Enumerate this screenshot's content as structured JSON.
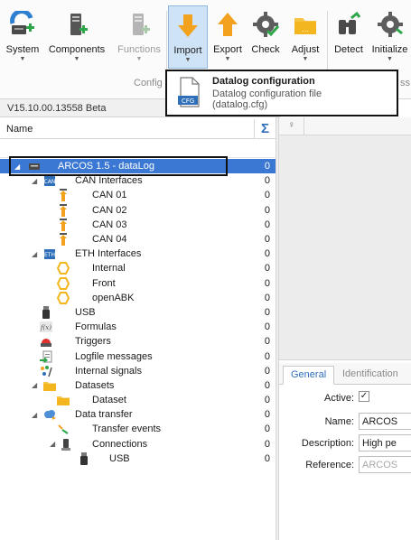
{
  "ribbon": {
    "buttons": [
      {
        "label": "System",
        "icon": "system-add-icon",
        "enabled": true
      },
      {
        "label": "Components",
        "icon": "components-add-icon",
        "enabled": true
      },
      {
        "label": "Functions",
        "icon": "functions-add-icon",
        "enabled": false
      },
      {
        "label": "Import",
        "icon": "import-arrow-icon",
        "enabled": true,
        "active": true
      },
      {
        "label": "Export",
        "icon": "export-arrow-icon",
        "enabled": true
      },
      {
        "label": "Check",
        "icon": "check-gear-icon",
        "enabled": true
      },
      {
        "label": "Adjust",
        "icon": "adjust-folder-icon",
        "enabled": true
      },
      {
        "label": "Detect",
        "icon": "detect-binoculars-icon",
        "enabled": true
      },
      {
        "label": "Initialize",
        "icon": "initialize-gear-icon",
        "enabled": true
      }
    ],
    "group_label": "Config",
    "group_label_right": "ss"
  },
  "version": "V15.10.00.13558 Beta",
  "tree": {
    "name_header": "Name",
    "sigma_header": "Σ",
    "rows": [
      {
        "label": "ARCOS 1.5 - dataLog",
        "count": "0",
        "icon": "device-icon",
        "expander": "◢",
        "selected": true
      },
      {
        "label": "CAN Interfaces",
        "count": "0",
        "icon": "can-interfaces-icon",
        "expander": "◢"
      },
      {
        "label": "CAN 01",
        "count": "0",
        "icon": "can-channel-icon"
      },
      {
        "label": "CAN 02",
        "count": "0",
        "icon": "can-channel-icon"
      },
      {
        "label": "CAN 03",
        "count": "0",
        "icon": "can-channel-icon"
      },
      {
        "label": "CAN 04",
        "count": "0",
        "icon": "can-channel-icon"
      },
      {
        "label": "ETH Interfaces",
        "count": "0",
        "icon": "eth-interfaces-icon",
        "expander": "◢"
      },
      {
        "label": "Internal",
        "count": "0",
        "icon": "eth-port-icon"
      },
      {
        "label": "Front",
        "count": "0",
        "icon": "eth-port-icon"
      },
      {
        "label": "openABK",
        "count": "0",
        "icon": "eth-port-icon"
      },
      {
        "label": "USB",
        "count": "0",
        "icon": "usb-icon"
      },
      {
        "label": "Formulas",
        "count": "0",
        "icon": "formula-icon"
      },
      {
        "label": "Triggers",
        "count": "0",
        "icon": "trigger-icon"
      },
      {
        "label": "Logfile messages",
        "count": "0",
        "icon": "logfile-icon"
      },
      {
        "label": "Internal signals",
        "count": "0",
        "icon": "signals-icon"
      },
      {
        "label": "Datasets",
        "count": "0",
        "icon": "folder-icon",
        "expander": "◢"
      },
      {
        "label": "Dataset",
        "count": "0",
        "icon": "dataset-folder-icon"
      },
      {
        "label": "Data transfer",
        "count": "0",
        "icon": "cloud-transfer-icon",
        "expander": "◢"
      },
      {
        "label": "Transfer events",
        "count": "0",
        "icon": "transfer-events-icon"
      },
      {
        "label": "Connections",
        "count": "0",
        "icon": "connections-icon",
        "expander": "◢"
      },
      {
        "label": "USB",
        "count": "0",
        "icon": "usb-icon"
      }
    ]
  },
  "right_pane": {
    "pin_glyph": "♀",
    "tabs": [
      "General",
      "Identification"
    ],
    "properties": {
      "active_label": "Active:",
      "active_checked": true,
      "name_label": "Name:",
      "name_value": "ARCOS",
      "description_label": "Description:",
      "description_value": "High pe",
      "reference_label": "Reference:",
      "reference_value": "ARCOS"
    }
  },
  "popup": {
    "title": "Datalog configuration",
    "subtitle": "Datalog configuration file",
    "filename": "(datalog.cfg)",
    "icon_text": "CFG"
  },
  "colors": {
    "selection": "#3b78d4",
    "accent_blue": "#2f6fba",
    "import_orange": "#f3a21f",
    "ribbon_active": "#cfe3f6"
  }
}
